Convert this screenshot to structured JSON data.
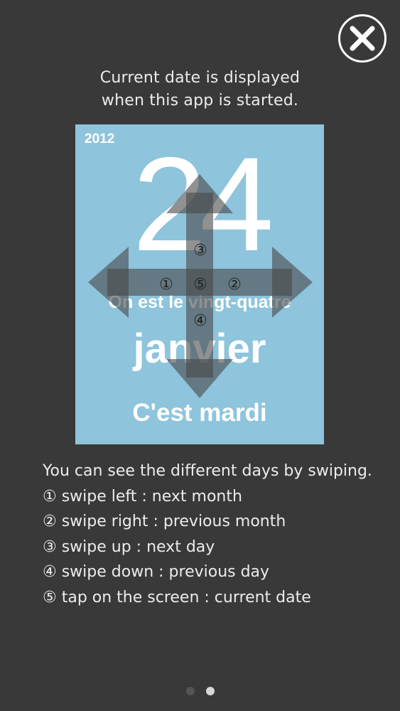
{
  "close": {
    "icon": "close-icon"
  },
  "intro": {
    "line1": "Current date is displayed",
    "line2": "when this app is started."
  },
  "calendar": {
    "year": "2012",
    "day": "24",
    "sentence": "On est le vingt-quatre",
    "month": "janvier",
    "weekday": "C'est mardi",
    "markers": {
      "left": "①",
      "right": "②",
      "up": "③",
      "down": "④",
      "tap": "⑤"
    },
    "background_color": "#8ec4dc"
  },
  "instructions": {
    "lead": "You can see the different days by swiping.",
    "items": [
      "① swipe left : next month",
      "② swipe right : previous month",
      "③ swipe up : next day",
      "④ swipe down : previous day",
      "⑤ tap on the screen : current date"
    ]
  },
  "pagination": {
    "total": 2,
    "current": 2
  }
}
